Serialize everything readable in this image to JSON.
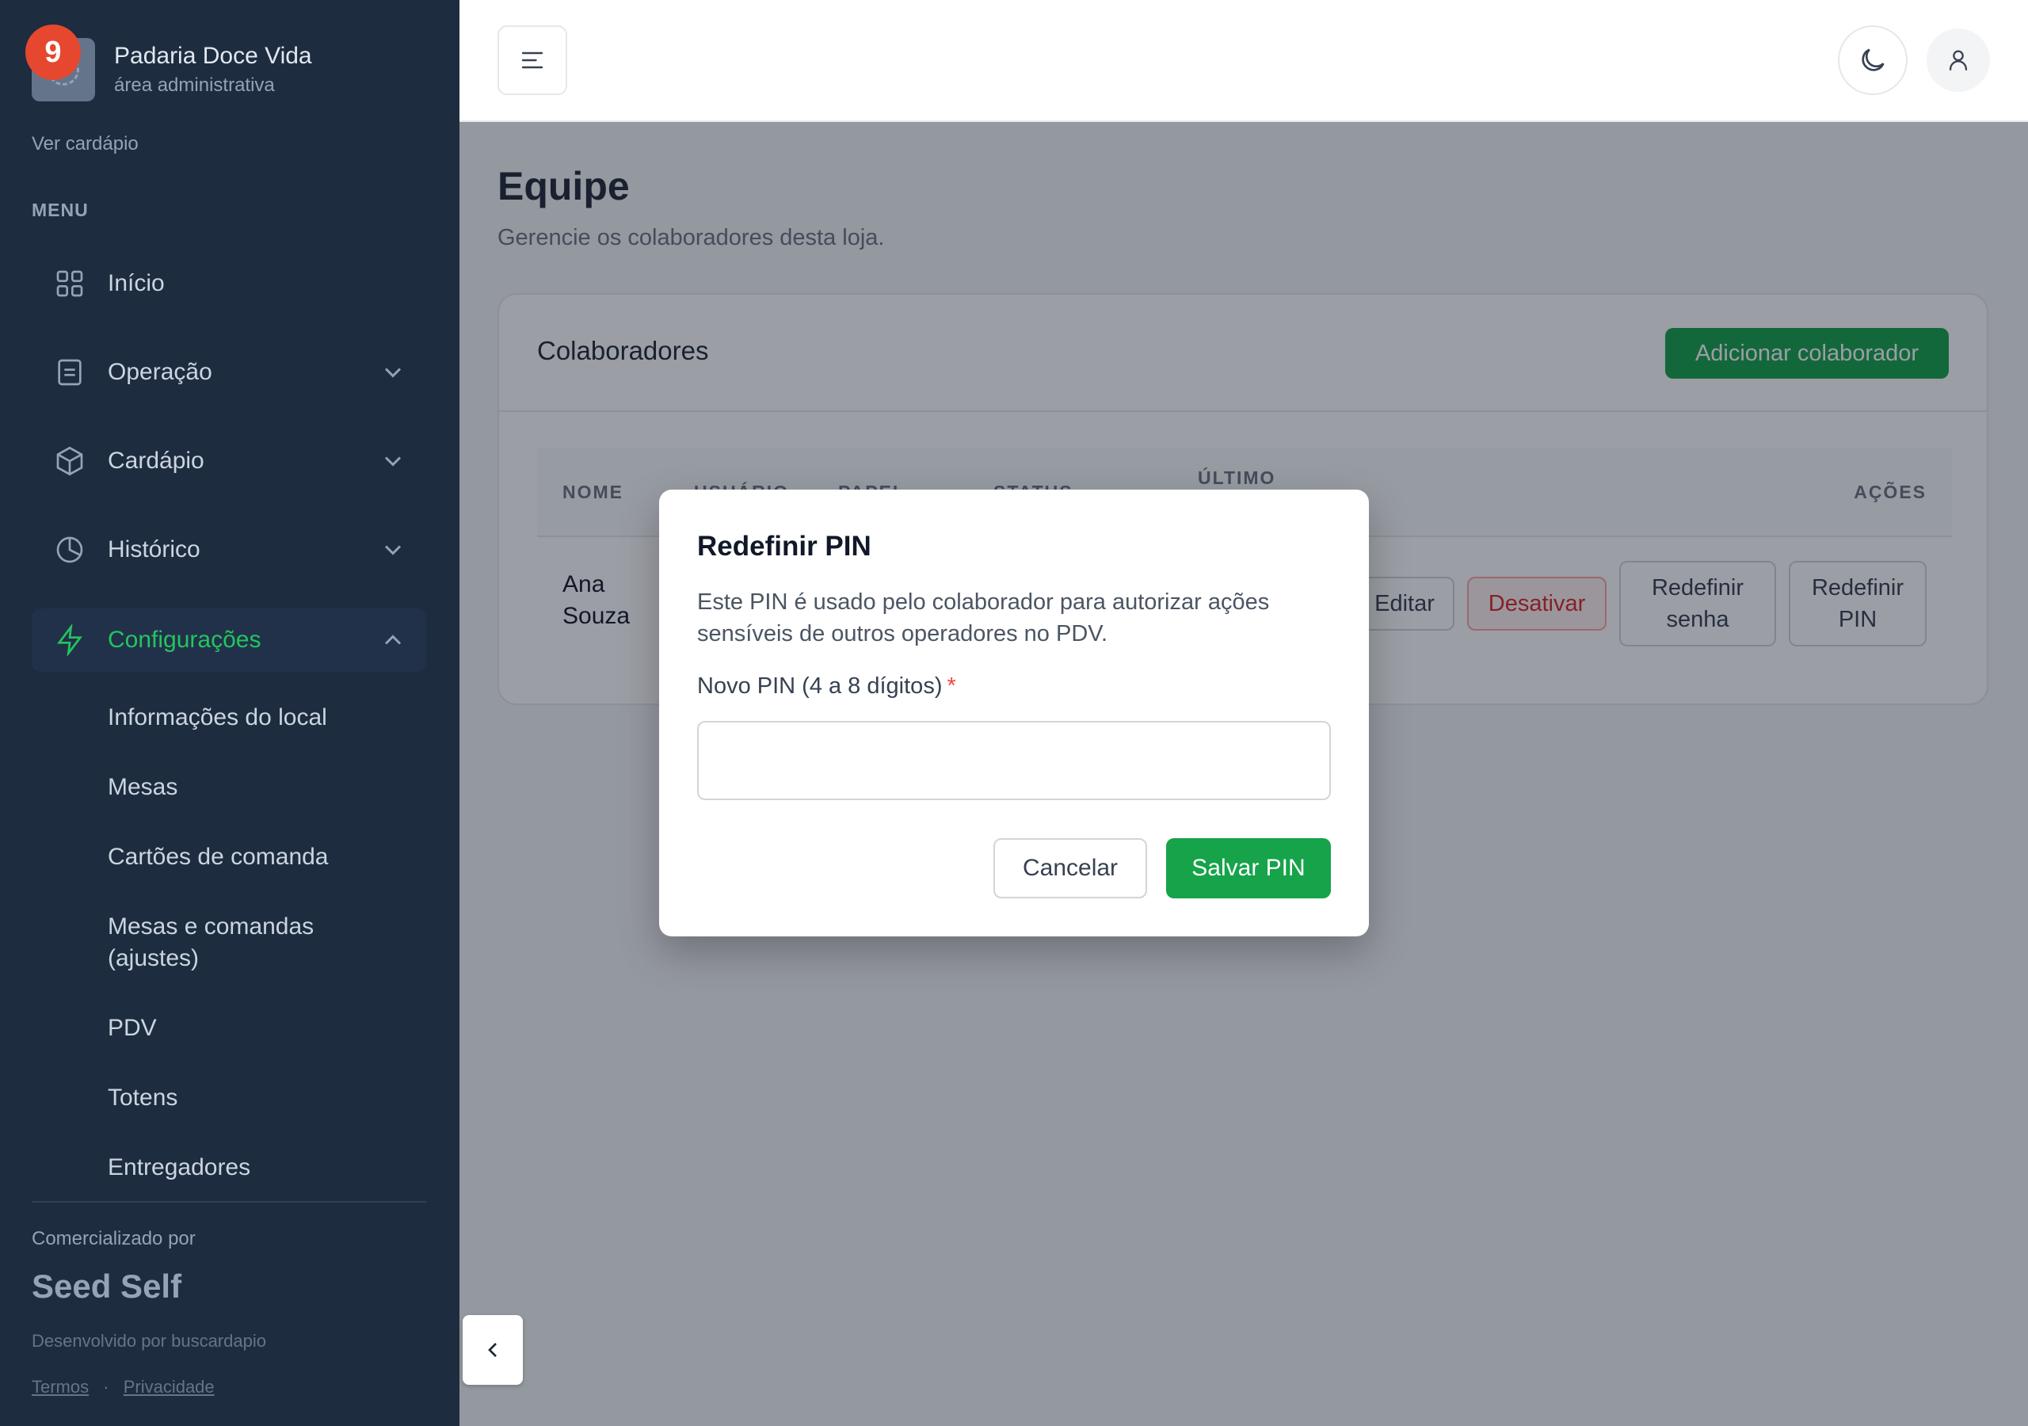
{
  "sidebar": {
    "notification_count": "9",
    "brand_name": "Padaria Doce Vida",
    "brand_sub": "área administrativa",
    "see_menu": "Ver cardápio",
    "menu_label": "MENU",
    "items": [
      {
        "label": "Início",
        "icon": "grid-icon"
      },
      {
        "label": "Operação",
        "icon": "clipboard-icon"
      },
      {
        "label": "Cardápio",
        "icon": "box-icon"
      },
      {
        "label": "Histórico",
        "icon": "pie-chart-icon"
      },
      {
        "label": "Configurações",
        "icon": "lightning-icon",
        "active": true
      }
    ],
    "sub_items": [
      "Informações do local",
      "Mesas",
      "Cartões de comanda",
      "Mesas e comandas (ajustes)",
      "PDV",
      "Totens",
      "Entregadores"
    ],
    "powered_by": "Comercializado por",
    "seed_brand": "Seed Self",
    "developed_by": "Desenvolvido por buscardapio",
    "terms": "Termos",
    "separator": "·",
    "privacy": "Privacidade"
  },
  "main": {
    "title": "Equipe",
    "subtitle": "Gerencie os colaboradores desta loja.",
    "card_title": "Colaboradores",
    "add_button": "Adicionar colaborador",
    "table": {
      "headers": [
        "NOME",
        "USUÁRIO",
        "PAPEL",
        "STATUS",
        "ÚLTIMO",
        "AÇÕES"
      ],
      "rows": [
        {
          "name": "Ana Souza",
          "actions": [
            "Editar",
            "Desativar",
            "Redefinir senha",
            "Redefinir PIN"
          ]
        }
      ]
    }
  },
  "modal": {
    "title": "Redefinir PIN",
    "description": "Este PIN é usado pelo colaborador para autorizar ações sensíveis de outros operadores no PDV.",
    "field_label": "Novo PIN (4 a 8 dígitos)",
    "required_mark": "*",
    "pin_value": "",
    "cancel": "Cancelar",
    "save": "Salvar PIN"
  },
  "colors": {
    "sidebar_bg": "#1e2c3f",
    "accent": "#16a34a",
    "danger": "#dc2626",
    "notification": "#e5482f"
  }
}
